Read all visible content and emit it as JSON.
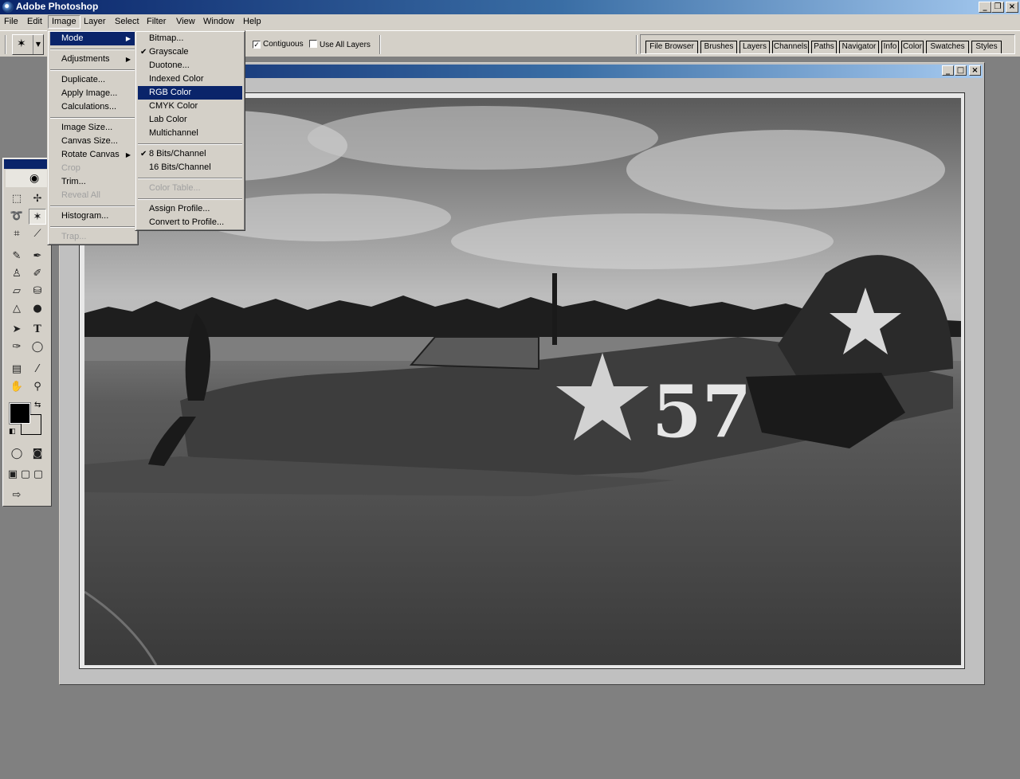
{
  "window": {
    "title": "Adobe Photoshop"
  },
  "menubar": [
    "File",
    "Edit",
    "Image",
    "Layer",
    "Select",
    "Filter",
    "View",
    "Window",
    "Help"
  ],
  "options": {
    "contiguous_label": "Contiguous",
    "contiguous_checked": true,
    "use_all_layers_label": "Use All Layers",
    "use_all_layers_checked": false
  },
  "palette_tabs": [
    "File Browser",
    "Brushes",
    "Layers",
    "Channels",
    "Paths",
    "Navigator",
    "Info",
    "Color",
    "Swatches",
    "Styles"
  ],
  "image_menu": {
    "items": [
      {
        "label": "Mode",
        "submenu": true,
        "highlighted": true
      },
      {
        "label": "Adjustments",
        "submenu": true
      },
      {
        "label": "Duplicate..."
      },
      {
        "label": "Apply Image..."
      },
      {
        "label": "Calculations..."
      },
      {
        "label": "Image Size..."
      },
      {
        "label": "Canvas Size..."
      },
      {
        "label": "Rotate Canvas",
        "submenu": true
      },
      {
        "label": "Crop",
        "disabled": true
      },
      {
        "label": "Trim..."
      },
      {
        "label": "Reveal All",
        "disabled": true
      },
      {
        "label": "Histogram..."
      },
      {
        "label": "Trap...",
        "disabled": true
      }
    ]
  },
  "mode_menu": {
    "items": [
      {
        "label": "Bitmap..."
      },
      {
        "label": "Grayscale",
        "checked": true
      },
      {
        "label": "Duotone..."
      },
      {
        "label": "Indexed Color"
      },
      {
        "label": "RGB Color",
        "highlighted": true
      },
      {
        "label": "CMYK Color"
      },
      {
        "label": "Lab Color"
      },
      {
        "label": "Multichannel"
      },
      {
        "label": "8 Bits/Channel",
        "checked": true
      },
      {
        "label": "16 Bits/Channel"
      },
      {
        "label": "Color Table...",
        "disabled": true
      },
      {
        "label": "Assign Profile..."
      },
      {
        "label": "Convert to Profile..."
      }
    ]
  },
  "photo": {
    "aircraft_number": "57"
  },
  "colors": {
    "menu_highlight": "#0a246a",
    "chrome": "#d4d0c8",
    "workspace": "#808080"
  }
}
